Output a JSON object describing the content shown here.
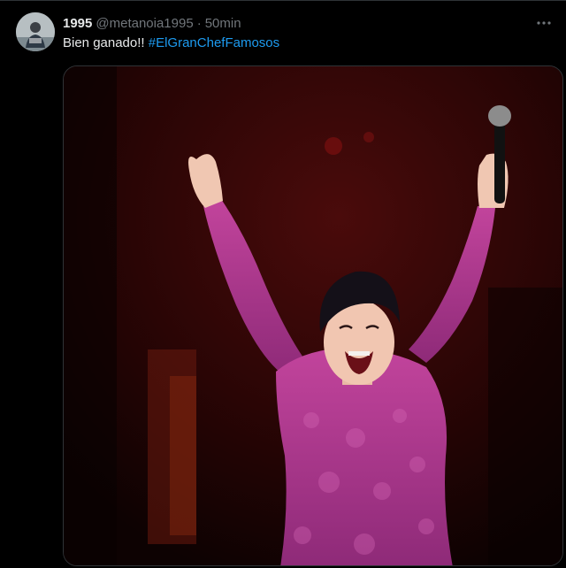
{
  "tweet": {
    "display_name": "1995",
    "handle": "@metanoia1995",
    "separator": "·",
    "time": "50min",
    "text": "Bien ganado!!",
    "hashtag": "#ElGranChefFamosos",
    "avatar_icon": "user-avatar",
    "more_icon": "more-dots-icon",
    "media_description_icon": "performer-photo"
  },
  "colors": {
    "background": "#000000",
    "text_primary": "#e7e9ea",
    "text_secondary": "#71767b",
    "link": "#1d9bf0",
    "dress": "#b0378f"
  }
}
